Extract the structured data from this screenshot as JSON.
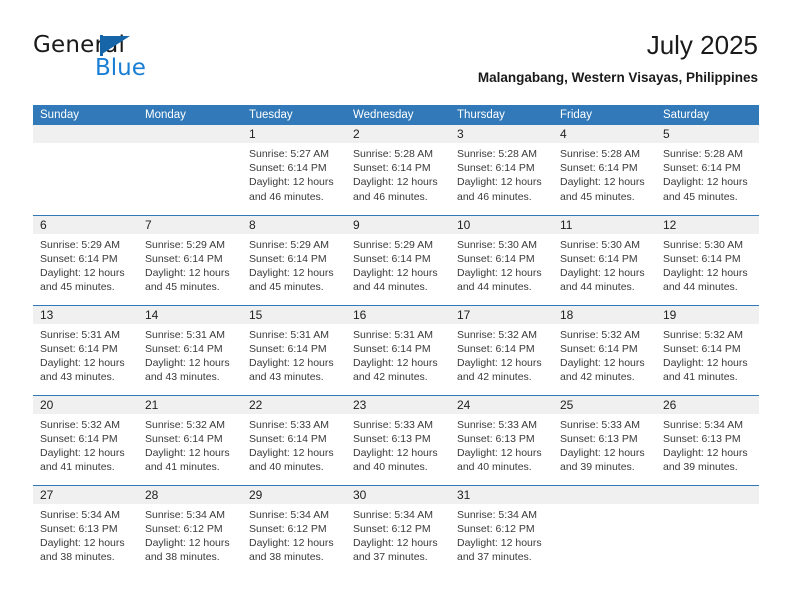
{
  "brand": {
    "name_top": "General",
    "name_bottom": "Blue",
    "accent_color": "#1a7fd4",
    "flag_color": "#1565a8"
  },
  "header": {
    "month_title": "July 2025",
    "location": "Malangabang, Western Visayas, Philippines"
  },
  "calendar": {
    "header_color": "#3179b8",
    "daynum_background": "#f0f0f0",
    "weekday_headers": [
      "Sunday",
      "Monday",
      "Tuesday",
      "Wednesday",
      "Thursday",
      "Friday",
      "Saturday"
    ],
    "weeks": [
      [
        {
          "day": "",
          "empty": true
        },
        {
          "day": "",
          "empty": true
        },
        {
          "day": "1",
          "sunrise": "Sunrise: 5:27 AM",
          "sunset": "Sunset: 6:14 PM",
          "daylight": "Daylight: 12 hours and 46 minutes."
        },
        {
          "day": "2",
          "sunrise": "Sunrise: 5:28 AM",
          "sunset": "Sunset: 6:14 PM",
          "daylight": "Daylight: 12 hours and 46 minutes."
        },
        {
          "day": "3",
          "sunrise": "Sunrise: 5:28 AM",
          "sunset": "Sunset: 6:14 PM",
          "daylight": "Daylight: 12 hours and 46 minutes."
        },
        {
          "day": "4",
          "sunrise": "Sunrise: 5:28 AM",
          "sunset": "Sunset: 6:14 PM",
          "daylight": "Daylight: 12 hours and 45 minutes."
        },
        {
          "day": "5",
          "sunrise": "Sunrise: 5:28 AM",
          "sunset": "Sunset: 6:14 PM",
          "daylight": "Daylight: 12 hours and 45 minutes."
        }
      ],
      [
        {
          "day": "6",
          "sunrise": "Sunrise: 5:29 AM",
          "sunset": "Sunset: 6:14 PM",
          "daylight": "Daylight: 12 hours and 45 minutes."
        },
        {
          "day": "7",
          "sunrise": "Sunrise: 5:29 AM",
          "sunset": "Sunset: 6:14 PM",
          "daylight": "Daylight: 12 hours and 45 minutes."
        },
        {
          "day": "8",
          "sunrise": "Sunrise: 5:29 AM",
          "sunset": "Sunset: 6:14 PM",
          "daylight": "Daylight: 12 hours and 45 minutes."
        },
        {
          "day": "9",
          "sunrise": "Sunrise: 5:29 AM",
          "sunset": "Sunset: 6:14 PM",
          "daylight": "Daylight: 12 hours and 44 minutes."
        },
        {
          "day": "10",
          "sunrise": "Sunrise: 5:30 AM",
          "sunset": "Sunset: 6:14 PM",
          "daylight": "Daylight: 12 hours and 44 minutes."
        },
        {
          "day": "11",
          "sunrise": "Sunrise: 5:30 AM",
          "sunset": "Sunset: 6:14 PM",
          "daylight": "Daylight: 12 hours and 44 minutes."
        },
        {
          "day": "12",
          "sunrise": "Sunrise: 5:30 AM",
          "sunset": "Sunset: 6:14 PM",
          "daylight": "Daylight: 12 hours and 44 minutes."
        }
      ],
      [
        {
          "day": "13",
          "sunrise": "Sunrise: 5:31 AM",
          "sunset": "Sunset: 6:14 PM",
          "daylight": "Daylight: 12 hours and 43 minutes."
        },
        {
          "day": "14",
          "sunrise": "Sunrise: 5:31 AM",
          "sunset": "Sunset: 6:14 PM",
          "daylight": "Daylight: 12 hours and 43 minutes."
        },
        {
          "day": "15",
          "sunrise": "Sunrise: 5:31 AM",
          "sunset": "Sunset: 6:14 PM",
          "daylight": "Daylight: 12 hours and 43 minutes."
        },
        {
          "day": "16",
          "sunrise": "Sunrise: 5:31 AM",
          "sunset": "Sunset: 6:14 PM",
          "daylight": "Daylight: 12 hours and 42 minutes."
        },
        {
          "day": "17",
          "sunrise": "Sunrise: 5:32 AM",
          "sunset": "Sunset: 6:14 PM",
          "daylight": "Daylight: 12 hours and 42 minutes."
        },
        {
          "day": "18",
          "sunrise": "Sunrise: 5:32 AM",
          "sunset": "Sunset: 6:14 PM",
          "daylight": "Daylight: 12 hours and 42 minutes."
        },
        {
          "day": "19",
          "sunrise": "Sunrise: 5:32 AM",
          "sunset": "Sunset: 6:14 PM",
          "daylight": "Daylight: 12 hours and 41 minutes."
        }
      ],
      [
        {
          "day": "20",
          "sunrise": "Sunrise: 5:32 AM",
          "sunset": "Sunset: 6:14 PM",
          "daylight": "Daylight: 12 hours and 41 minutes."
        },
        {
          "day": "21",
          "sunrise": "Sunrise: 5:32 AM",
          "sunset": "Sunset: 6:14 PM",
          "daylight": "Daylight: 12 hours and 41 minutes."
        },
        {
          "day": "22",
          "sunrise": "Sunrise: 5:33 AM",
          "sunset": "Sunset: 6:14 PM",
          "daylight": "Daylight: 12 hours and 40 minutes."
        },
        {
          "day": "23",
          "sunrise": "Sunrise: 5:33 AM",
          "sunset": "Sunset: 6:13 PM",
          "daylight": "Daylight: 12 hours and 40 minutes."
        },
        {
          "day": "24",
          "sunrise": "Sunrise: 5:33 AM",
          "sunset": "Sunset: 6:13 PM",
          "daylight": "Daylight: 12 hours and 40 minutes."
        },
        {
          "day": "25",
          "sunrise": "Sunrise: 5:33 AM",
          "sunset": "Sunset: 6:13 PM",
          "daylight": "Daylight: 12 hours and 39 minutes."
        },
        {
          "day": "26",
          "sunrise": "Sunrise: 5:34 AM",
          "sunset": "Sunset: 6:13 PM",
          "daylight": "Daylight: 12 hours and 39 minutes."
        }
      ],
      [
        {
          "day": "27",
          "sunrise": "Sunrise: 5:34 AM",
          "sunset": "Sunset: 6:13 PM",
          "daylight": "Daylight: 12 hours and 38 minutes."
        },
        {
          "day": "28",
          "sunrise": "Sunrise: 5:34 AM",
          "sunset": "Sunset: 6:12 PM",
          "daylight": "Daylight: 12 hours and 38 minutes."
        },
        {
          "day": "29",
          "sunrise": "Sunrise: 5:34 AM",
          "sunset": "Sunset: 6:12 PM",
          "daylight": "Daylight: 12 hours and 38 minutes."
        },
        {
          "day": "30",
          "sunrise": "Sunrise: 5:34 AM",
          "sunset": "Sunset: 6:12 PM",
          "daylight": "Daylight: 12 hours and 37 minutes."
        },
        {
          "day": "31",
          "sunrise": "Sunrise: 5:34 AM",
          "sunset": "Sunset: 6:12 PM",
          "daylight": "Daylight: 12 hours and 37 minutes."
        },
        {
          "day": "",
          "empty": true
        },
        {
          "day": "",
          "empty": true
        }
      ]
    ]
  }
}
